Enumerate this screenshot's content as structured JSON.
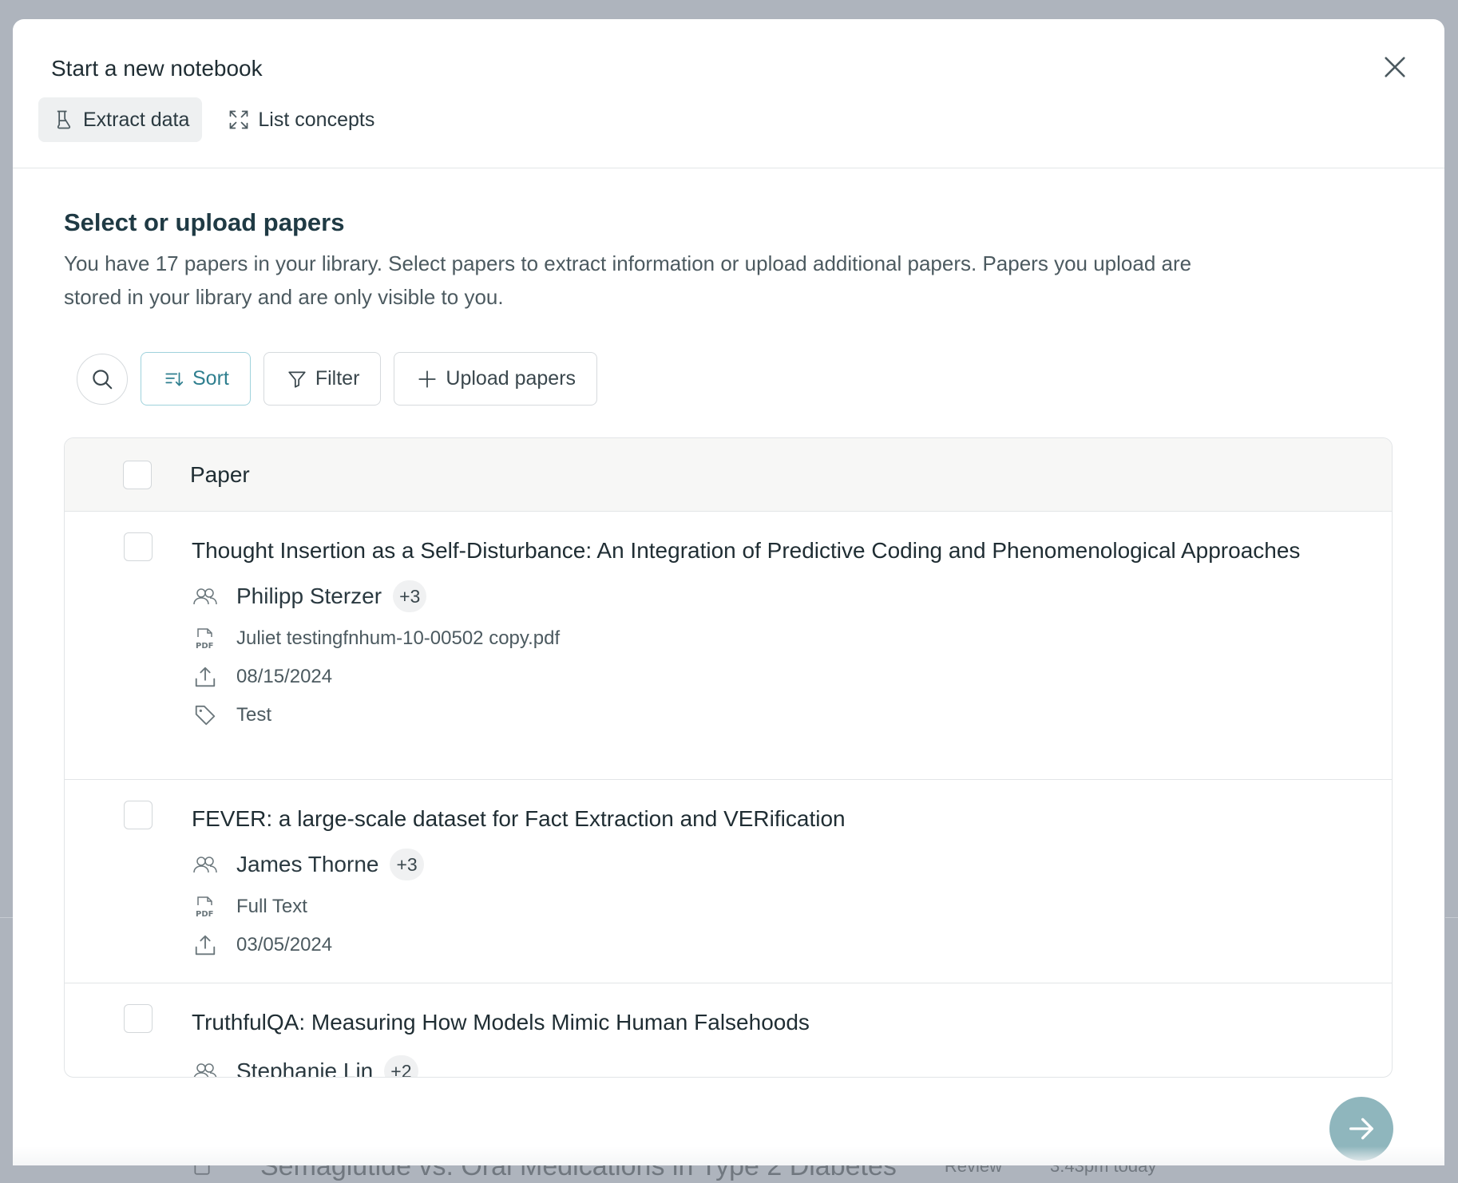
{
  "background": {
    "row_title": "Semaglutide vs. Oral Medications in Type 2 Diabetes",
    "row_type": "Review",
    "row_time": "3:43pm today"
  },
  "modal": {
    "title": "Start a new notebook",
    "tabs": [
      {
        "label": "Extract data",
        "icon": "flask-icon",
        "active": true
      },
      {
        "label": "List concepts",
        "icon": "expand-icon",
        "active": false
      }
    ]
  },
  "section": {
    "title": "Select or upload papers",
    "description": "You have 17 papers in your library. Select papers to extract information or upload additional papers. Papers you upload are stored in your library and are only visible to you."
  },
  "toolbar": {
    "sort_label": "Sort",
    "filter_label": "Filter",
    "upload_label": "Upload papers"
  },
  "table": {
    "column_header": "Paper",
    "rows": [
      {
        "title": "Thought Insertion as a Self-Disturbance: An Integration of Predictive Coding and Phenomenological Approaches",
        "author": "Philipp Sterzer",
        "more_authors": "+3",
        "file": "Juliet testingfnhum-10-00502 copy.pdf",
        "date": "08/15/2024",
        "tag": "Test"
      },
      {
        "title": "FEVER: a large-scale dataset for Fact Extraction and VERification",
        "author": "James Thorne",
        "more_authors": "+3",
        "file": "Full Text",
        "date": "03/05/2024"
      },
      {
        "title": "TruthfulQA: Measuring How Models Mimic Human Falsehoods",
        "author": "Stephanie Lin",
        "more_authors": "+2"
      }
    ]
  },
  "colors": {
    "accent": "#2f7f8f",
    "accent_border": "#9fd2dc",
    "next_button": "#8fb6bd",
    "overlay": "#aeb4bd"
  }
}
